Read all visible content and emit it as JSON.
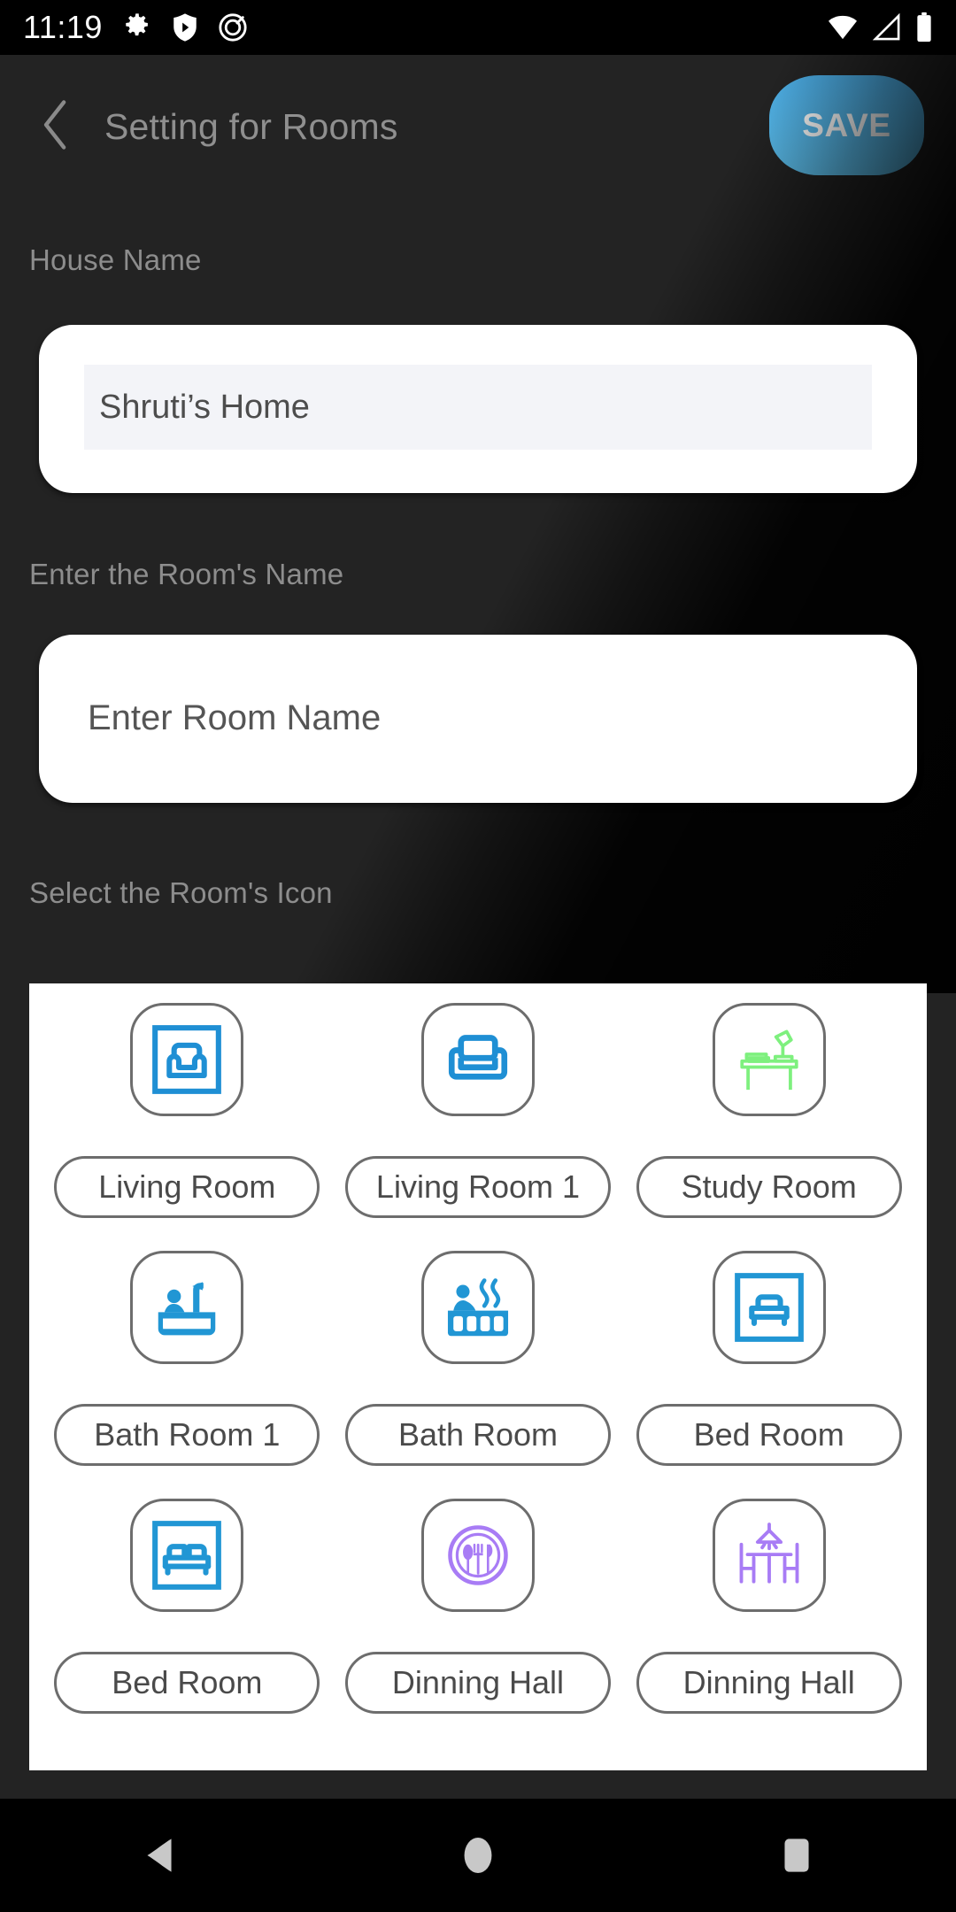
{
  "status_bar": {
    "time": "11:19",
    "left_icons": [
      "gear-icon",
      "play-shield-icon",
      "circle-slash-icon"
    ],
    "right_icons": [
      "wifi-icon",
      "signal-icon",
      "battery-icon"
    ]
  },
  "app_bar": {
    "back_icon": "chevron-left-icon",
    "title": "Setting for Rooms",
    "save_label": "SAVE",
    "save_color": "#57bdee"
  },
  "form": {
    "house_name_label": "House Name",
    "house_name_value": "Shruti’s Home",
    "room_name_label": "Enter the Room's Name",
    "room_name_value": "",
    "room_name_placeholder": "Enter Room Name"
  },
  "icon_picker": {
    "section_label": "Select the Room's Icon",
    "items": [
      {
        "label": "Living Room",
        "icon": "armchair-framed-icon",
        "color": "#1f8fd4"
      },
      {
        "label": "Living Room 1",
        "icon": "sofa-icon",
        "color": "#1f8fd4"
      },
      {
        "label": "Study Room",
        "icon": "desk-lamp-icon",
        "color": "#7ef07e"
      },
      {
        "label": "Bath Room 1",
        "icon": "bathtub-person-icon",
        "color": "#2196d4"
      },
      {
        "label": "Bath Room",
        "icon": "hot-spring-icon",
        "color": "#2196d4"
      },
      {
        "label": "Bed Room",
        "icon": "bed-framed-icon",
        "color": "#2196d4"
      },
      {
        "label": "Bed Room",
        "icon": "double-bed-framed-icon",
        "color": "#2196d4"
      },
      {
        "label": "Dinning Hall",
        "icon": "plate-cutlery-icon",
        "color": "#a87cf5"
      },
      {
        "label": "Dinning Hall",
        "icon": "dining-table-icon",
        "color": "#a87cf5"
      }
    ]
  },
  "nav_bar": {
    "back_icon": "triangle-back-icon",
    "home_icon": "circle-home-icon",
    "recents_icon": "square-recents-icon"
  }
}
